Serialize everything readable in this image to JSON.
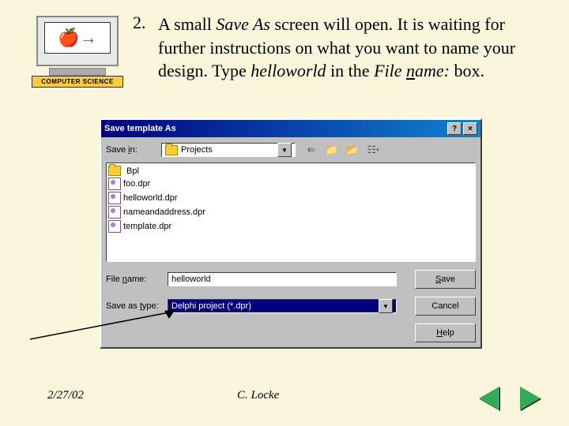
{
  "logo": {
    "label": "COMPUTER SCIENCE"
  },
  "step": {
    "number": "2.",
    "text_parts": {
      "a": "A small ",
      "saveas": "Save As",
      "b": " screen will open. It is waiting for further instructions on what you want to name your design. Type ",
      "helloworld": "helloworld",
      "c": " in the ",
      "file": "File ",
      "name_u": "n",
      "name_rest": "ame:",
      "d": " box."
    }
  },
  "dialog": {
    "title": "Save template As",
    "help_btn": "?",
    "close_btn": "×",
    "save_in_label_pre": "Save ",
    "save_in_u": "i",
    "save_in_label_post": "n:",
    "save_in_value": "Projects",
    "files": [
      {
        "name": "Bpl",
        "type": "folder"
      },
      {
        "name": "foo.dpr",
        "type": "file"
      },
      {
        "name": "helloworld.dpr",
        "type": "file"
      },
      {
        "name": "nameandaddress.dpr",
        "type": "file"
      },
      {
        "name": "template.dpr",
        "type": "file"
      }
    ],
    "file_name_label_pre": "File ",
    "file_name_u": "n",
    "file_name_label_post": "ame:",
    "file_name_value": "helloworld",
    "save_as_type_label_pre": "Save as ",
    "save_as_type_u": "t",
    "save_as_type_label_post": "ype:",
    "save_as_type_value": "Delphi project (*.dpr)",
    "btn_save_u": "S",
    "btn_save_rest": "ave",
    "btn_cancel": "Cancel",
    "btn_help_u": "H",
    "btn_help_rest": "elp"
  },
  "footer": {
    "date": "2/27/02",
    "author": "C. Locke"
  }
}
